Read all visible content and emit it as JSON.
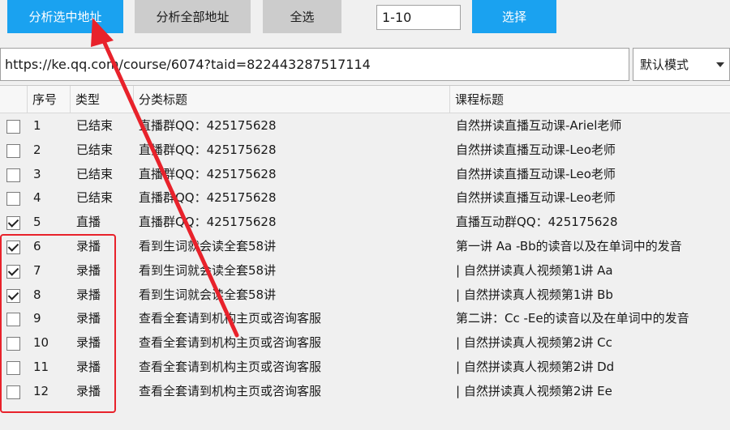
{
  "toolbar": {
    "analyze_selected": "分析选中地址",
    "analyze_all": "分析全部地址",
    "select_all": "全选",
    "range_value": "1-10",
    "choose": "选择"
  },
  "address": {
    "url": "https://ke.qq.com/course/6074?taid=822443287517114",
    "mode": "默认模式"
  },
  "table": {
    "headers": {
      "no": "序号",
      "type": "类型",
      "category": "分类标题",
      "course": "课程标题"
    },
    "rows": [
      {
        "checked": false,
        "no": "1",
        "type": "已结束",
        "category": "直播群QQ：425175628",
        "course": "自然拼读直播互动课-Ariel老师"
      },
      {
        "checked": false,
        "no": "2",
        "type": "已结束",
        "category": "直播群QQ：425175628",
        "course": "自然拼读直播互动课-Leo老师"
      },
      {
        "checked": false,
        "no": "3",
        "type": "已结束",
        "category": "直播群QQ：425175628",
        "course": "自然拼读直播互动课-Leo老师"
      },
      {
        "checked": false,
        "no": "4",
        "type": "已结束",
        "category": "直播群QQ：425175628",
        "course": "自然拼读直播互动课-Leo老师"
      },
      {
        "checked": true,
        "no": "5",
        "type": "直播",
        "category": "直播群QQ：425175628",
        "course": "直播互动群QQ：425175628"
      },
      {
        "checked": true,
        "no": "6",
        "type": "录播",
        "category": "看到生词就会读全套58讲",
        "course": "第一讲 Aa -Bb的读音以及在单词中的发音"
      },
      {
        "checked": true,
        "no": "7",
        "type": "录播",
        "category": "看到生词就会读全套58讲",
        "course": "| 自然拼读真人视频第1讲 Aa"
      },
      {
        "checked": true,
        "no": "8",
        "type": "录播",
        "category": "看到生词就会读全套58讲",
        "course": "| 自然拼读真人视频第1讲 Bb"
      },
      {
        "checked": false,
        "no": "9",
        "type": "录播",
        "category": "查看全套请到机构主页或咨询客服",
        "course": "第二讲：Cc -Ee的读音以及在单词中的发音"
      },
      {
        "checked": false,
        "no": "10",
        "type": "录播",
        "category": "查看全套请到机构主页或咨询客服",
        "course": "| 自然拼读真人视频第2讲 Cc"
      },
      {
        "checked": false,
        "no": "11",
        "type": "录播",
        "category": "查看全套请到机构主页或咨询客服",
        "course": "| 自然拼读真人视频第2讲 Dd"
      },
      {
        "checked": false,
        "no": "12",
        "type": "录播",
        "category": "查看全套请到机构主页或咨询客服",
        "course": "| 自然拼读真人视频第2讲 Ee"
      }
    ]
  },
  "colors": {
    "accent": "#1aa2f0",
    "annotation": "#e8222b"
  },
  "icons": {
    "dropdown": "chevron-down-icon",
    "annotation_arrow": "red-arrow-icon"
  }
}
